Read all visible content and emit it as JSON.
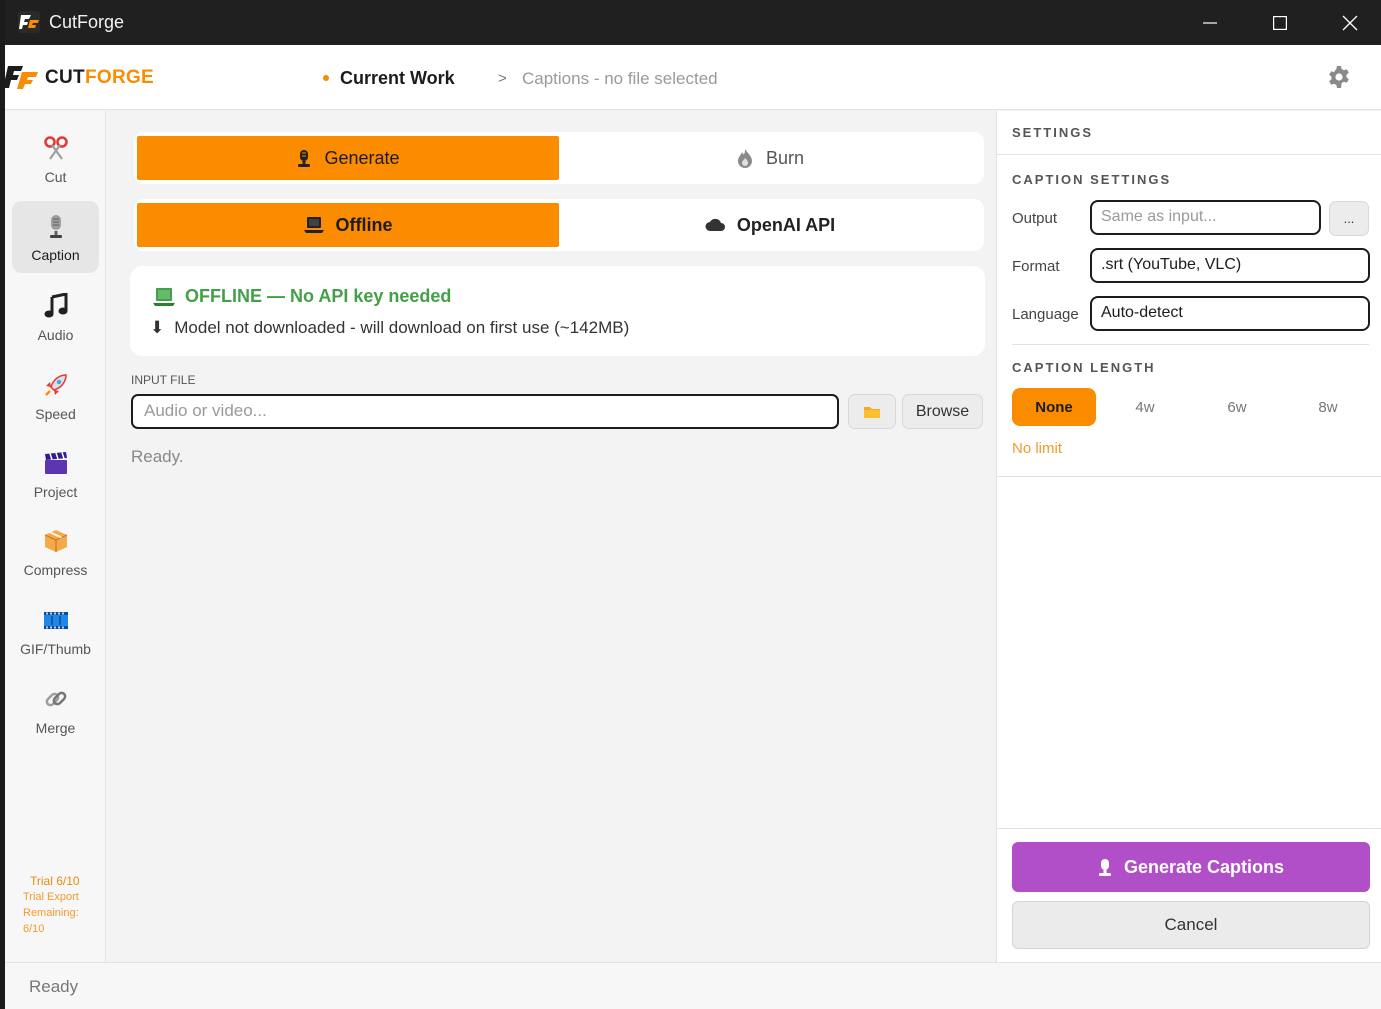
{
  "window": {
    "title": "CutForge"
  },
  "header": {
    "brand_cut": "CUT",
    "brand_forge": "FORGE",
    "crumb_current": "Current Work",
    "crumb_sep": ">",
    "crumb_sub": "Captions - no file selected"
  },
  "sidebar": {
    "items": [
      {
        "label": "Cut",
        "icon": "scissors-icon"
      },
      {
        "label": "Caption",
        "icon": "microphone-icon"
      },
      {
        "label": "Audio",
        "icon": "music-note-icon"
      },
      {
        "label": "Speed",
        "icon": "rocket-icon"
      },
      {
        "label": "Project",
        "icon": "clapperboard-icon"
      },
      {
        "label": "Compress",
        "icon": "package-icon"
      },
      {
        "label": "GIF/Thumb",
        "icon": "film-strip-icon"
      },
      {
        "label": "Merge",
        "icon": "link-icon"
      }
    ],
    "active": "Caption",
    "trial_title": "Trial 6/10",
    "trial_l1": "Trial Export",
    "trial_l2": "Remaining:",
    "trial_l3": "6/10"
  },
  "main": {
    "mode_tabs": [
      {
        "label": "Generate",
        "selected": true
      },
      {
        "label": "Burn",
        "selected": false
      }
    ],
    "engine_tabs": [
      {
        "label": "Offline",
        "selected": true
      },
      {
        "label": "OpenAI API",
        "selected": false
      }
    ],
    "status_head": "OFFLINE — No API key needed",
    "status_arrow": "⬇",
    "status_sub": "Model not downloaded - will download on first use (~142MB)",
    "input_label": "INPUT FILE",
    "input_placeholder": "Audio or video...",
    "browse_label": "Browse",
    "ready_text": "Ready."
  },
  "settings": {
    "title": "SETTINGS",
    "caption_settings": "CAPTION SETTINGS",
    "output_label": "Output",
    "output_placeholder": "Same as input...",
    "dots_label": "...",
    "format_label": "Format",
    "format_value": ".srt (YouTube, VLC)",
    "language_label": "Language",
    "language_value": "Auto-detect",
    "caption_length": "CAPTION LENGTH",
    "length_options": [
      "None",
      "4w",
      "6w",
      "8w"
    ],
    "length_selected": "None",
    "length_hint": "No limit",
    "generate_label": "Generate Captions",
    "cancel_label": "Cancel"
  },
  "statusbar": {
    "text": "Ready"
  },
  "colors": {
    "accent": "#fb8c00",
    "purple": "#b14fc9",
    "success": "#43a047"
  }
}
